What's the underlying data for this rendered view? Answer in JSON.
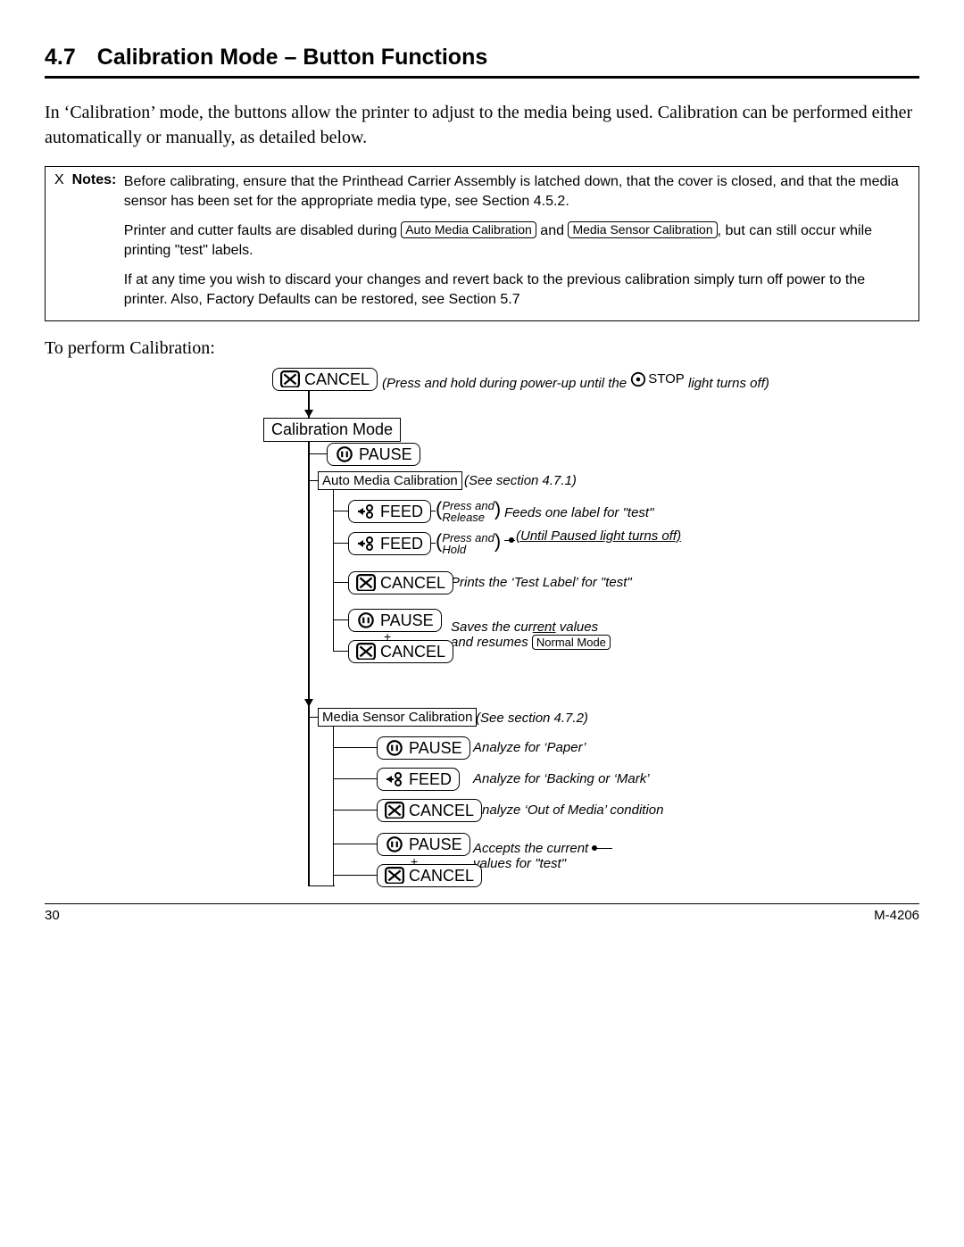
{
  "section_number": "4.7",
  "section_title": "Calibration Mode – Button Functions",
  "intro": "In ‘Calibration’ mode, the buttons allow the printer to adjust to the media being used. Calibration can be performed either automatically or manually, as detailed below.",
  "notes_lead_mark": "X",
  "notes_label": "Notes:",
  "notes_p1": "Before calibrating, ensure that the Printhead Carrier Assembly is latched down, that the cover is closed, and that the media sensor has been set for the appropriate media type, see Section 4.5.2.",
  "notes_p2a": "Printer and cutter faults are disabled during ",
  "notes_btn1": "Auto Media Calibration",
  "notes_mid": " and ",
  "notes_btn2": "Media Sensor Calibration",
  "notes_p2b": ", but can still occur while printing \"test\" labels.",
  "notes_p3": "If at any time you wish to discard your changes and revert back to the previous calibration simply turn off power to the printer. Also, Factory Defaults can be restored, see Section 5.7",
  "perform": "To perform Calibration:",
  "labels": {
    "cancel": "CANCEL",
    "pause": "PAUSE",
    "feed": "FEED",
    "stop": "STOP",
    "calib_mode": "Calibration Mode",
    "auto_media": "Auto Media Calibration",
    "media_sensor": "Media Sensor Calibration",
    "normal_mode": "Normal Mode"
  },
  "notes_text": {
    "top": "(Press and hold during power-up until the",
    "top2": " light turns off)",
    "auto_see": "(See section 4.7.1)",
    "feed1a": "Press and",
    "feed1b": "Release",
    "feed1c": "Feeds one label for \"test\"",
    "feed2a": "Press and",
    "feed2b": "Hold",
    "feed2c": "(Until Paused light turns off)",
    "c1": "Prints the ‘Test Label’ for \"test\"",
    "save1": "Saves the cur",
    "save_rent": "rent",
    "save2": " values",
    "save3": "and resumes",
    "ms_see": "(See section 4.7.2)",
    "ms_pause": "Analyze for ‘Paper’",
    "ms_feed": "Analyze for ‘Backing or ‘Mark’",
    "ms_cancel": "Analyze ‘Out of Media’ condition",
    "acc1": "Accepts the current",
    "acc2": "values for \"test\""
  },
  "footer": {
    "page": "30",
    "model": "M-4206"
  }
}
